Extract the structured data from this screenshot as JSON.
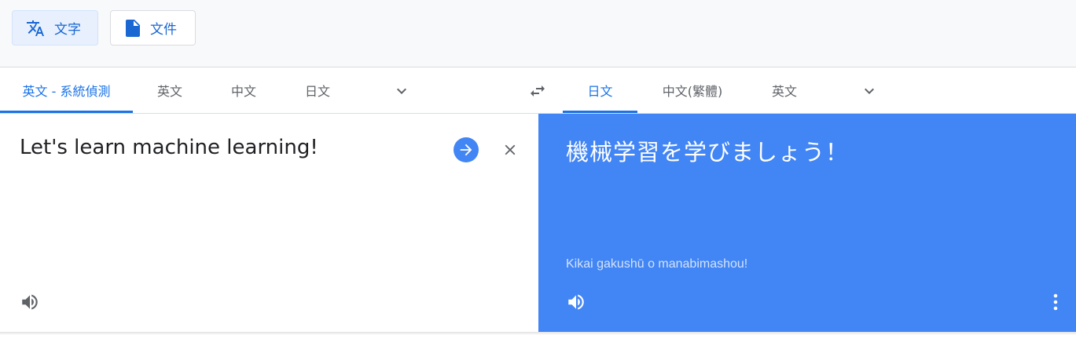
{
  "mode_bar": {
    "text_label": "文字",
    "documents_label": "文件"
  },
  "source_langs": {
    "tabs": [
      {
        "label": "英文 - 系統偵測",
        "active": true
      },
      {
        "label": "英文",
        "active": false
      },
      {
        "label": "中文",
        "active": false
      },
      {
        "label": "日文",
        "active": false
      }
    ]
  },
  "target_langs": {
    "tabs": [
      {
        "label": "日文",
        "active": true
      },
      {
        "label": "中文(繁體)",
        "active": false
      },
      {
        "label": "英文",
        "active": false
      }
    ]
  },
  "source": {
    "text": "Let's learn machine learning!"
  },
  "target": {
    "text": "機械学習を学びましょう！",
    "romanization": "Kikai gakushū o manabimashou!"
  },
  "colors": {
    "accent": "#1a73e8",
    "target_panel": "#4285f4",
    "active_mode_bg": "#e8f0fe"
  },
  "icons": {
    "text_mode": "translate-icon",
    "documents_mode": "document-icon",
    "dropdown": "chevron-down-icon",
    "swap": "swap-languages-icon",
    "translate_go": "arrow-right-icon",
    "clear": "close-icon",
    "listen": "speaker-icon",
    "more": "more-vert-icon"
  }
}
